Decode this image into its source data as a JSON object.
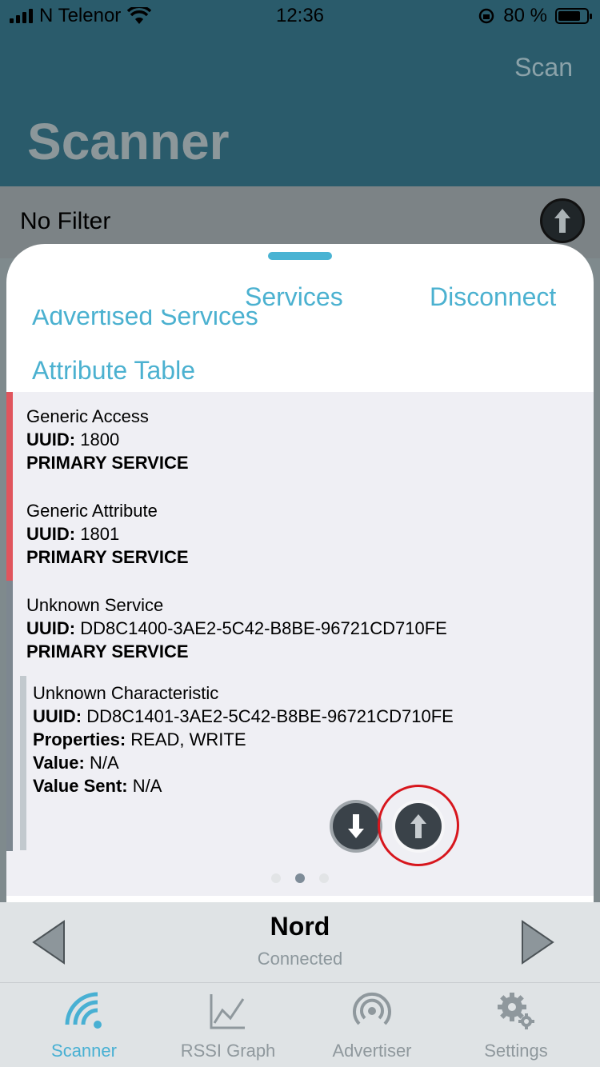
{
  "status_bar": {
    "carrier": "N Telenor",
    "time": "12:36",
    "battery_percent": "80 %",
    "battery_level": 0.8
  },
  "nav": {
    "title": "Scanner",
    "action": "Scan"
  },
  "filter": {
    "label": "No Filter"
  },
  "sheet": {
    "tabs": {
      "services": "Services",
      "disconnect": "Disconnect"
    },
    "cut_heading": "Advertised Services",
    "attribute_heading": "Attribute Table",
    "services": [
      {
        "name": "Generic Access",
        "uuid_label": "UUID:",
        "uuid": "1800",
        "type": "PRIMARY SERVICE",
        "color": "#e0555d"
      },
      {
        "name": "Generic Attribute",
        "uuid_label": "UUID:",
        "uuid": "1801",
        "type": "PRIMARY SERVICE",
        "color": "#e0555d"
      },
      {
        "name": "Unknown Service",
        "uuid_label": "UUID:",
        "uuid": "DD8C1400-3AE2-5C42-B8BE-96721CD710FE",
        "type": "PRIMARY SERVICE",
        "color": "#7d8790"
      }
    ],
    "characteristic": {
      "name": "Unknown Characteristic",
      "uuid_label": "UUID:",
      "uuid": "DD8C1401-3AE2-5C42-B8BE-96721CD710FE",
      "properties_label": "Properties:",
      "properties": "READ, WRITE",
      "value_label": "Value:",
      "value": "N/A",
      "value_sent_label": "Value Sent:",
      "value_sent": "N/A"
    },
    "page_dots": {
      "count": 3,
      "active_index": 1
    }
  },
  "peripheral": {
    "name": "Nord",
    "state": "Connected"
  },
  "tab_bar": {
    "items": [
      {
        "label": "Scanner",
        "icon": "scanner-waves-icon",
        "active": true
      },
      {
        "label": "RSSI Graph",
        "icon": "line-graph-icon",
        "active": false
      },
      {
        "label": "Advertiser",
        "icon": "broadcast-icon",
        "active": false
      },
      {
        "label": "Settings",
        "icon": "gears-icon",
        "active": false
      }
    ]
  },
  "colors": {
    "accent": "#4bb1d0",
    "highlight_ring": "#d7161d"
  }
}
